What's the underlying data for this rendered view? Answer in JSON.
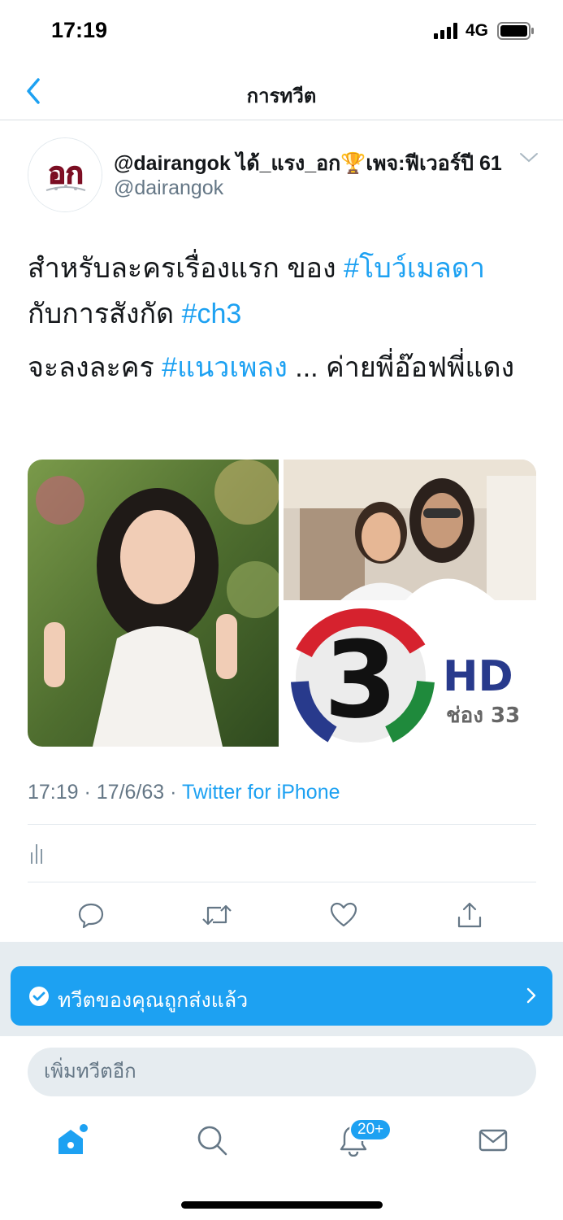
{
  "status_bar": {
    "time": "17:19",
    "network": "4G"
  },
  "header": {
    "title": "การทวีต"
  },
  "tweet": {
    "avatar_text": "อก",
    "display_name": "@dairangok ได้_แรง_อก🏆เพจ:ฟีเวอร์ปี 61",
    "username": "@dairangok",
    "line1_text": "สำหรับละครเรื่องแรก ของ ",
    "line1_hashtag": "#โบว์เมลดา",
    "line2_text": "กับการสังกัด ",
    "line2_hashtag": "#ch3",
    "line3_text": "จะลงละคร ",
    "line3_hashtag": "#แนวเพลง",
    "line3_rest": " ... ค่ายพี่อ๊อฟพี่แดง",
    "channel_logo_number": "3",
    "channel_logo_hd": "HD",
    "channel_logo_sub": "ช่อง 33",
    "timestamp": "17:19 · 17/6/63 · ",
    "source": "Twitter for iPhone"
  },
  "banner": {
    "text": "ทวีตของคุณถูกส่งแล้ว"
  },
  "reply": {
    "placeholder": "เพิ่มทวีตอีก"
  },
  "tab_bar": {
    "notification_badge": "20+"
  },
  "colors": {
    "accent": "#1da1f2",
    "muted": "#657786",
    "gray_bg": "#e6ecf0"
  },
  "icons": [
    "back-chevron-icon",
    "chevron-down-icon",
    "analytics-icon",
    "reply-icon",
    "retweet-icon",
    "like-icon",
    "share-icon",
    "check-circle-icon",
    "chevron-right-icon",
    "home-icon",
    "search-icon",
    "notifications-icon",
    "messages-icon"
  ]
}
